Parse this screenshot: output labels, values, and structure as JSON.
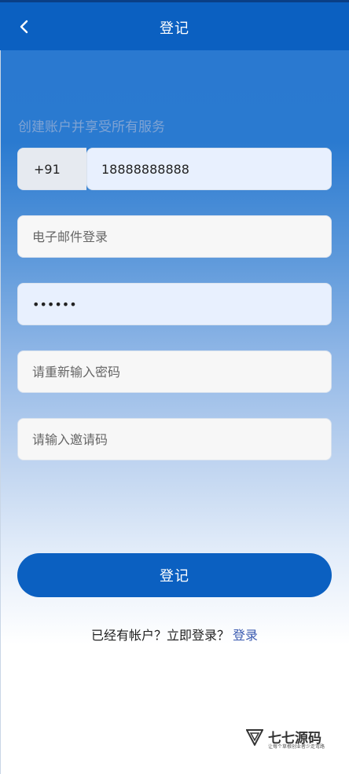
{
  "header": {
    "title": "登记",
    "back_icon": "chevron-left-icon"
  },
  "form": {
    "subtitle": "创建账户并享受所有服务",
    "country_code": "+91",
    "phone_value": "18888888888",
    "email_placeholder": "电子邮件登录",
    "password_value": "123456",
    "confirm_password_placeholder": "请重新输入密码",
    "invite_placeholder": "请输入邀请码",
    "submit_label": "登记"
  },
  "footer": {
    "prompt": "已经有帐户？立即登录？",
    "login_link": "登录"
  },
  "watermark": {
    "name": "七七源码",
    "tagline": "让每个草根创业者少走弯路"
  },
  "colors": {
    "primary": "#0b60c1",
    "link": "#3a5ab0",
    "subtitle": "#7fa3d3"
  }
}
